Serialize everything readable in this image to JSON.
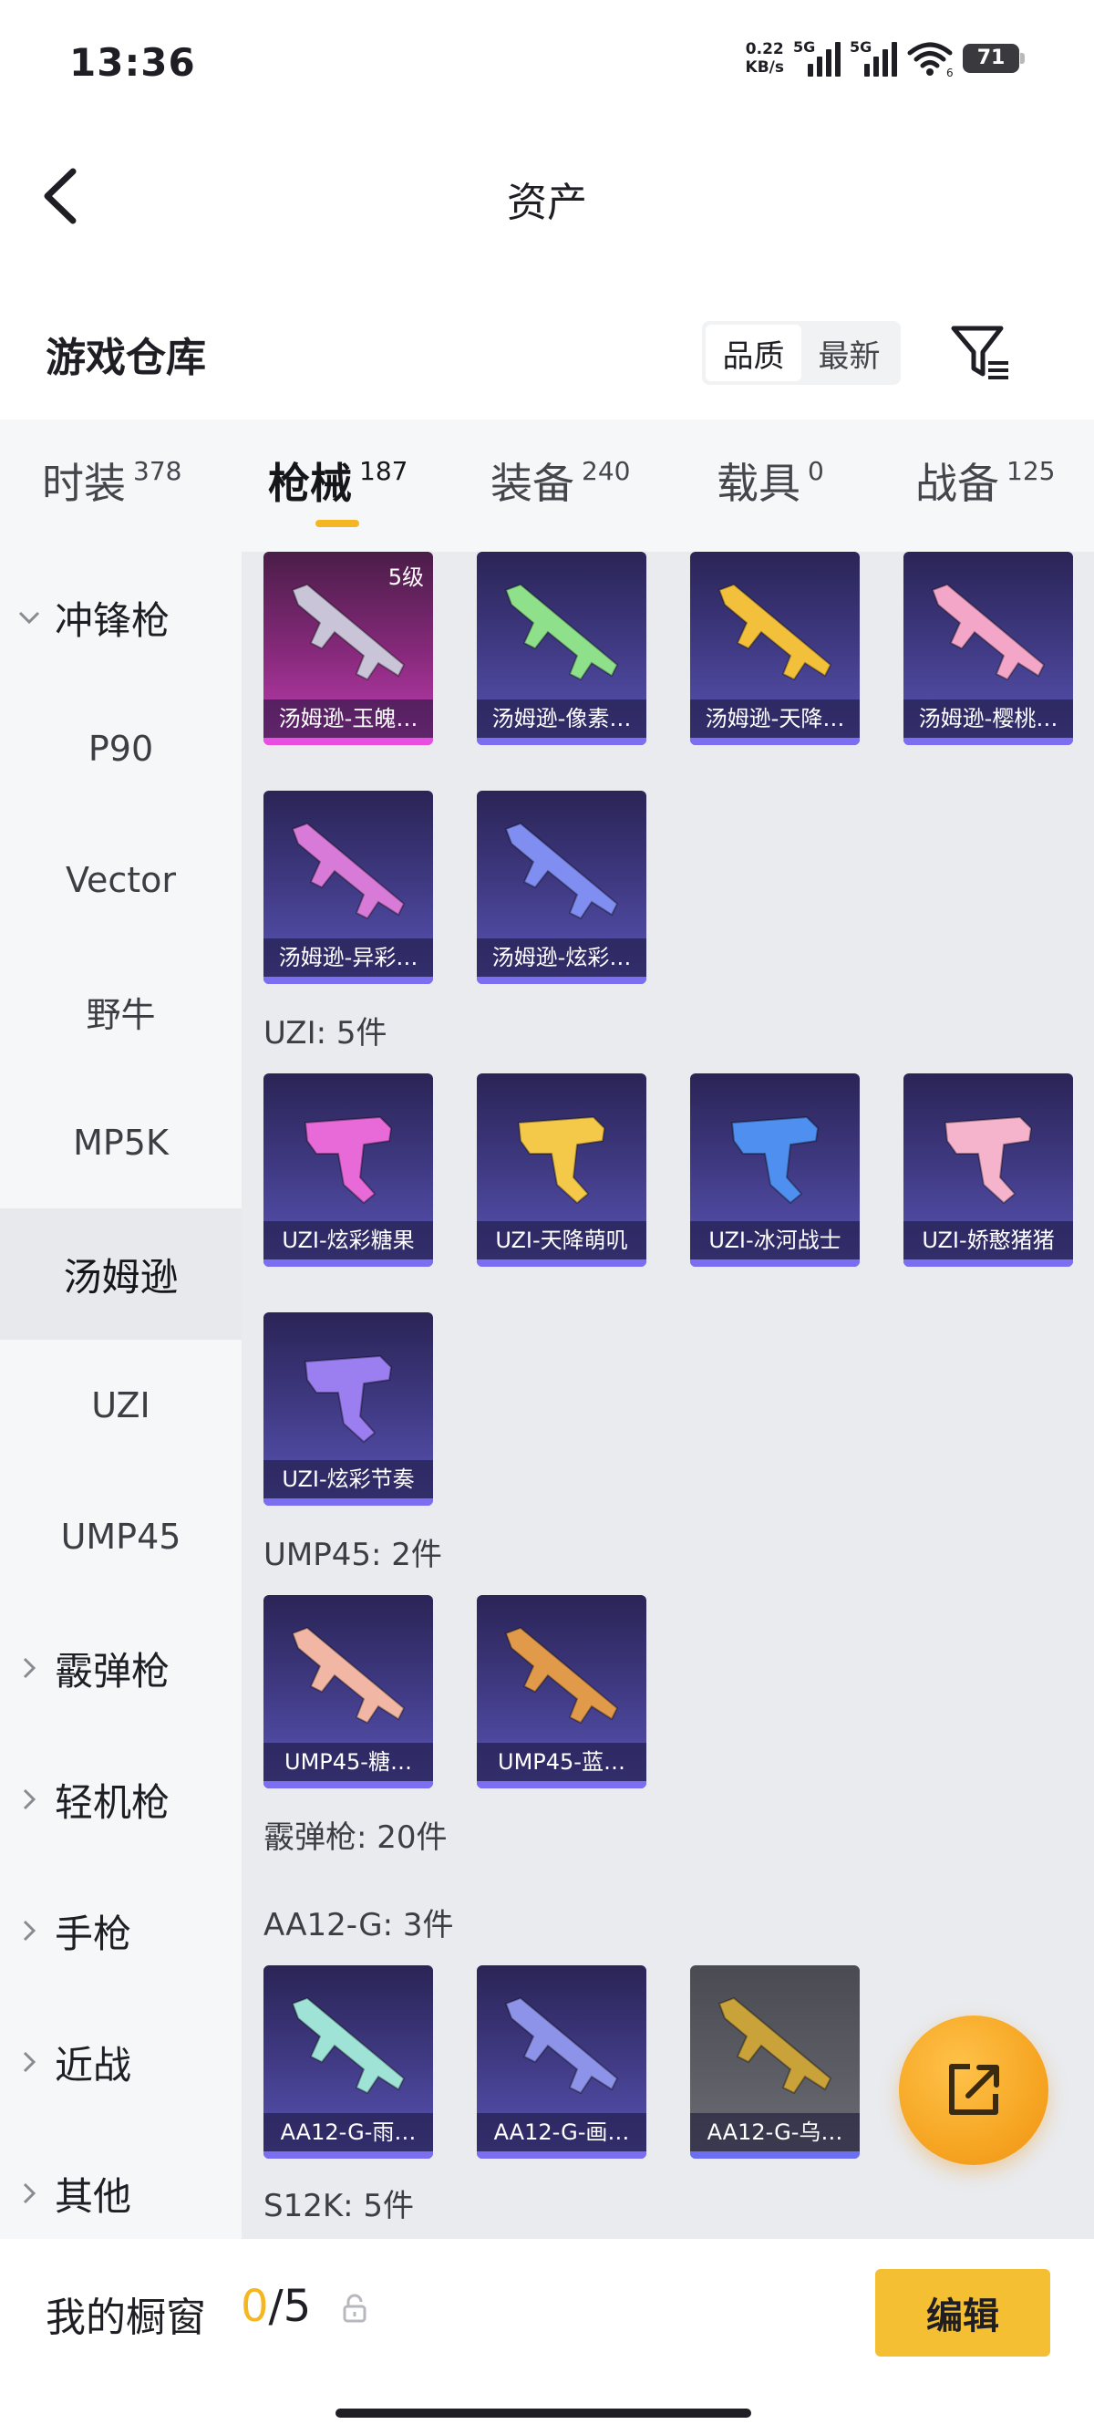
{
  "status_bar": {
    "time": "13:36",
    "speed_value": "0.22",
    "speed_unit": "KB/s",
    "sim1": "5G",
    "sim2": "5G",
    "wifi_badge": "6",
    "battery": "71"
  },
  "header": {
    "title": "资产"
  },
  "warehouse": {
    "title": "游戏仓库",
    "sort_options": [
      "品质",
      "最新"
    ],
    "sort_selected": "品质"
  },
  "tabs": [
    {
      "label": "时装",
      "count": "378"
    },
    {
      "label": "枪械",
      "count": "187"
    },
    {
      "label": "装备",
      "count": "240"
    },
    {
      "label": "载具",
      "count": "0"
    },
    {
      "label": "战备",
      "count": "125"
    }
  ],
  "active_tab": "枪械",
  "sidebar": [
    {
      "label": "冲锋枪",
      "group": true,
      "expanded": true
    },
    {
      "label": "P90"
    },
    {
      "label": "Vector"
    },
    {
      "label": "野牛"
    },
    {
      "label": "MP5K"
    },
    {
      "label": "汤姆逊",
      "active": true
    },
    {
      "label": "UZI"
    },
    {
      "label": "UMP45"
    },
    {
      "label": "霰弹枪",
      "group": true
    },
    {
      "label": "轻机枪",
      "group": true
    },
    {
      "label": "手枪",
      "group": true
    },
    {
      "label": "近战",
      "group": true
    },
    {
      "label": "其他",
      "group": true
    }
  ],
  "content": {
    "tommy_items": [
      {
        "name": "汤姆逊-玉魄…",
        "level": "5级",
        "rarity": "legendary",
        "gun_color": "#c9c4d8"
      },
      {
        "name": "汤姆逊-像素…",
        "rarity": "epic",
        "gun_color": "#8ee08a"
      },
      {
        "name": "汤姆逊-天降…",
        "rarity": "epic",
        "gun_color": "#f2c03a"
      },
      {
        "name": "汤姆逊-樱桃…",
        "rarity": "epic",
        "gun_color": "#f3a6c8"
      },
      {
        "name": "汤姆逊-异彩…",
        "rarity": "epic",
        "gun_color": "#d77ad8"
      },
      {
        "name": "汤姆逊-炫彩…",
        "rarity": "epic",
        "gun_color": "#7f8ef0"
      }
    ],
    "uzi_label": "UZI: 5件",
    "uzi_items": [
      {
        "name": "UZI-炫彩糖果",
        "rarity": "epic",
        "gun_color": "#e86ad8"
      },
      {
        "name": "UZI-天降萌叽",
        "rarity": "epic",
        "gun_color": "#f4c94a"
      },
      {
        "name": "UZI-冰河战士",
        "rarity": "epic",
        "gun_color": "#4f8ff0"
      },
      {
        "name": "UZI-娇憨猪猪",
        "rarity": "epic",
        "gun_color": "#f5b3cc"
      },
      {
        "name": "UZI-炫彩节奏",
        "rarity": "epic",
        "gun_color": "#9b7ef0"
      }
    ],
    "ump_label": "UMP45: 2件",
    "ump_items": [
      {
        "name": "UMP45-糖…",
        "rarity": "epic",
        "gun_color": "#f2b7a4"
      },
      {
        "name": "UMP45-蓝…",
        "rarity": "epic",
        "gun_color": "#e19a4a"
      }
    ],
    "shotgun_label": "霰弹枪: 20件",
    "aa12_label": "AA12-G: 3件",
    "aa12_items": [
      {
        "name": "AA12-G-雨…",
        "rarity": "epic",
        "gun_color": "#9fe3d6"
      },
      {
        "name": "AA12-G-画…",
        "rarity": "epic",
        "gun_color": "#8d93e8"
      },
      {
        "name": "AA12-G-乌…",
        "rarity": "rare",
        "gun_color": "#c9a23a"
      }
    ],
    "s12k_label": "S12K: 5件"
  },
  "fab": {
    "icon": "share-out-icon"
  },
  "bottom": {
    "label": "我的橱窗",
    "count_current": "0",
    "count_total": "/5",
    "edit_label": "编辑"
  },
  "colors": {
    "accent": "#f5b624",
    "card_epic": "#3e3880",
    "card_legendary": "#8a2a7e",
    "card_rare": "#5d5e66"
  }
}
